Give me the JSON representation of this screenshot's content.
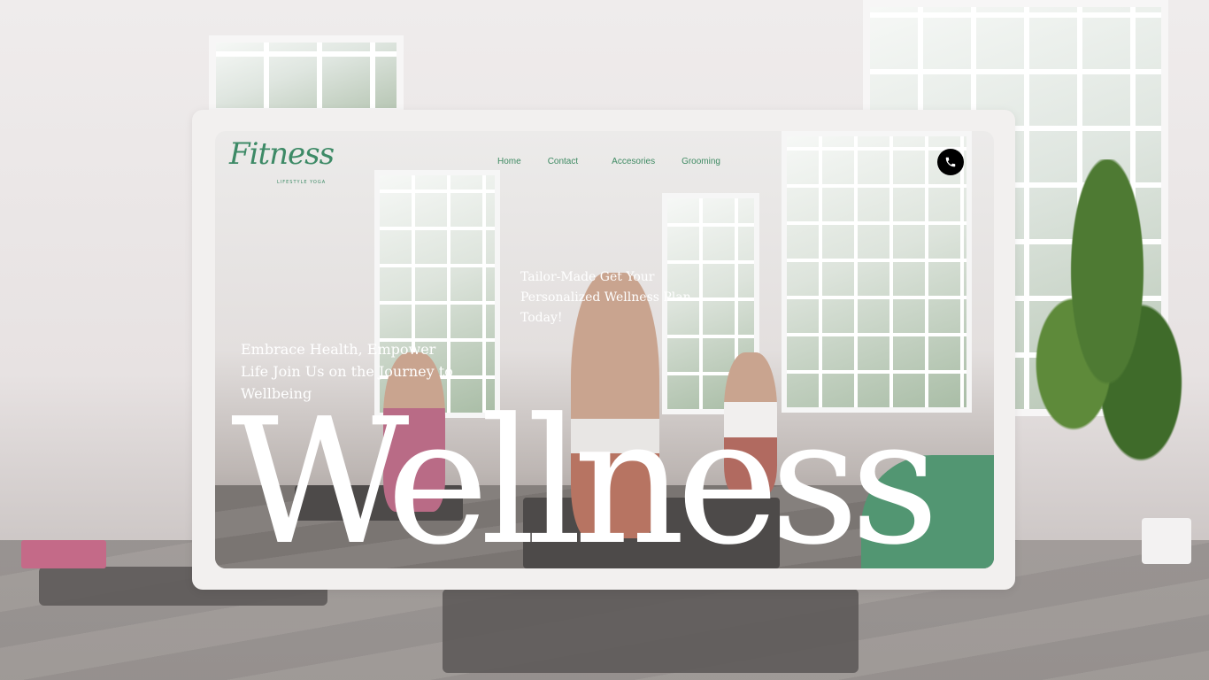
{
  "brand": {
    "logo_script": "Fitness",
    "logo_sub": "LIFESTYLE YOGA"
  },
  "nav": {
    "items": [
      "Home",
      "Contact",
      "Accesories",
      "Grooming"
    ]
  },
  "phone_icon": "phone-icon",
  "tagline": "Tailor-Made Get Your Personalized Wellness Plan Today!",
  "intro": "Embrace Health, Empower Life Join Us on the Journey to Wellbeing",
  "hero_word": "Wellness",
  "colors": {
    "accent": "#529672",
    "nav_text": "#3f8a63",
    "frame": "#f2f0ef",
    "phone_button": "#000000"
  }
}
